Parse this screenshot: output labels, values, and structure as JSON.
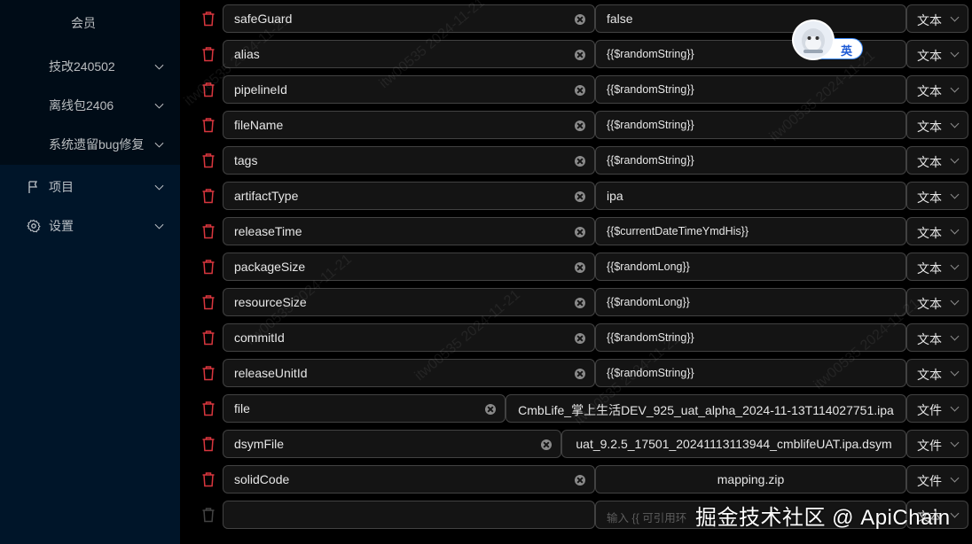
{
  "sidebar": {
    "top_item": "会员",
    "sub_items": [
      {
        "label": "技改240502"
      },
      {
        "label": "离线包2406"
      },
      {
        "label": "系统遗留bug修复"
      }
    ],
    "items": [
      {
        "label": "项目",
        "icon": "flag-icon"
      },
      {
        "label": "设置",
        "icon": "gear-icon"
      }
    ]
  },
  "params": [
    {
      "key": "safeGuard",
      "value": "false",
      "type": "文本"
    },
    {
      "key": "alias",
      "value": "{{$randomString}}",
      "type": "文本"
    },
    {
      "key": "pipelineId",
      "value": "{{$randomString}}",
      "type": "文本"
    },
    {
      "key": "fileName",
      "value": "{{$randomString}}",
      "type": "文本"
    },
    {
      "key": "tags",
      "value": "{{$randomString}}",
      "type": "文本"
    },
    {
      "key": "artifactType",
      "value": "ipa",
      "type": "文本"
    },
    {
      "key": "releaseTime",
      "value": "{{$currentDateTimeYmdHis}}",
      "type": "文本"
    },
    {
      "key": "packageSize",
      "value": "{{$randomLong}}",
      "type": "文本"
    },
    {
      "key": "resourceSize",
      "value": "{{$randomLong}}",
      "type": "文本"
    },
    {
      "key": "commitId",
      "value": "{{$randomString}}",
      "type": "文本"
    },
    {
      "key": "releaseUnitId",
      "value": "{{$randomString}}",
      "type": "文本"
    },
    {
      "key": "file",
      "value": "CmbLife_掌上生活DEV_925_uat_alpha_2024-11-13T114027751.ipa",
      "type": "文件"
    },
    {
      "key": "dsymFile",
      "value": "uat_9.2.5_17501_20241113113944_cmblifeUAT.ipa.dsym",
      "type": "文件"
    },
    {
      "key": "solidCode",
      "value": "mapping.zip",
      "type": "文件"
    }
  ],
  "new_row": {
    "value_placeholder": "输入 {{ 可引用环",
    "type": "文本"
  },
  "ime": {
    "label": "英"
  },
  "watermark": {
    "bottom": "掘金技术社区 @ ApiChain",
    "diagonal": "itw00535 2024-11-21"
  },
  "colors": {
    "sidebar_bg": "#001529",
    "submenu_bg": "#000c17",
    "delete_icon": "#d9363e",
    "input_bg": "#141414",
    "input_border": "#424242"
  }
}
